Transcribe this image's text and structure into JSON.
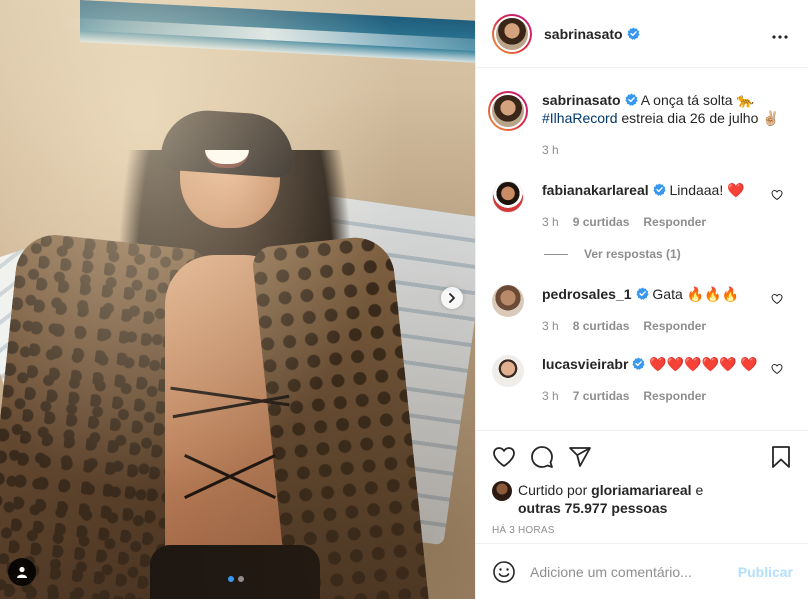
{
  "post": {
    "author": "sabrinasato",
    "verified_color": "#3897f0"
  },
  "caption": {
    "username": "sabrinasato",
    "text_before": "A onça tá solta 🐆",
    "hashtag": "#IlhaRecord",
    "text_after": "estreia dia 26 de julho ✌🏼",
    "time": "3 h"
  },
  "comments": [
    {
      "username": "fabianakarlareal",
      "text": "Lindaaa! ❤️",
      "time": "3 h",
      "likes": "9 curtidas",
      "reply": "Responder"
    },
    {
      "username": "pedrosales_1",
      "text": "Gata 🔥🔥🔥",
      "time": "3 h",
      "likes": "8 curtidas",
      "reply": "Responder"
    },
    {
      "username": "lucasvieirabr",
      "text": "❤️❤️❤️❤️❤️ ❤️",
      "time": "3 h",
      "likes": "7 curtidas",
      "reply": "Responder"
    }
  ],
  "view_replies": "Ver respostas (1)",
  "likes": {
    "prefix": "Curtido por",
    "user": "gloriamariareal",
    "conj": "e",
    "others": "outras 75.977 pessoas"
  },
  "time_ago": "HÁ 3 HORAS",
  "add_comment": {
    "placeholder": "Adicione um comentário...",
    "publish": "Publicar"
  },
  "icons": {
    "more": "more-horizontal-icon",
    "like": "heart-icon",
    "comment": "comment-icon",
    "share": "paper-plane-icon",
    "save": "bookmark-icon",
    "emoji": "emoji-icon",
    "user_tag": "user-icon",
    "next": "chevron-right-icon"
  },
  "carousel": {
    "slides": 2,
    "active_index": 0
  }
}
